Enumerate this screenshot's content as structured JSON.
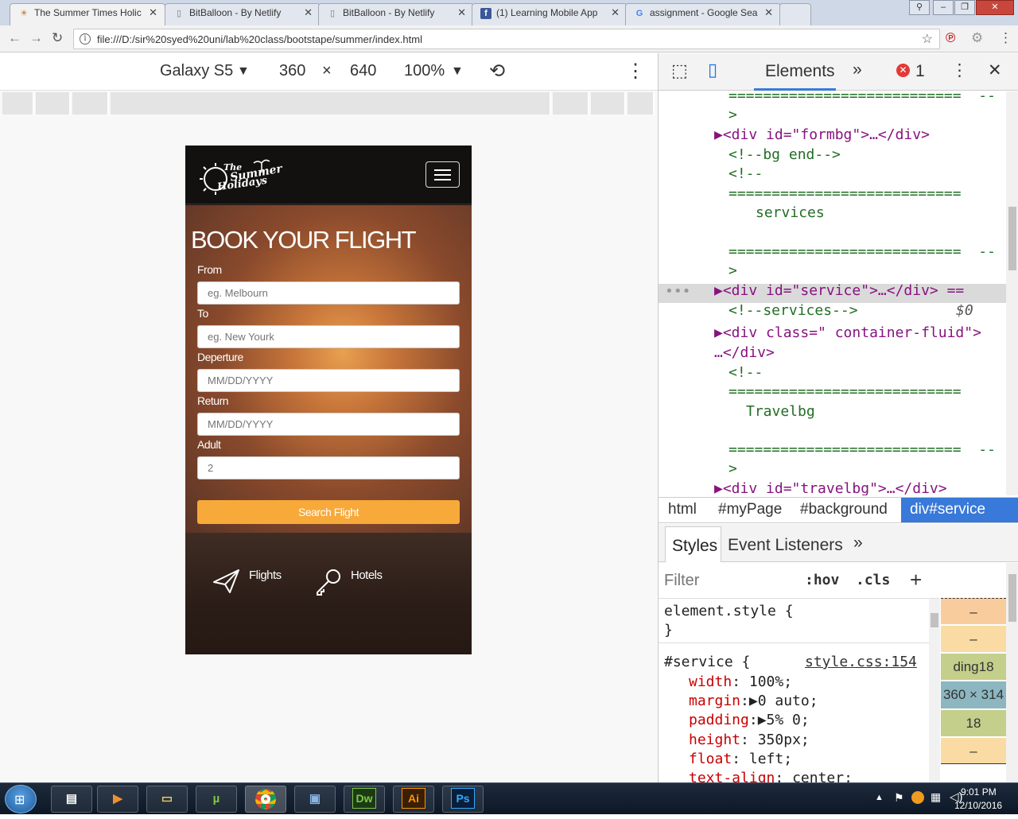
{
  "browser": {
    "tabs": [
      {
        "title": "The Summer Times Holic",
        "icon": "palm-favicon",
        "active": true
      },
      {
        "title": "BitBalloon - By Netlify",
        "icon": "page-favicon"
      },
      {
        "title": "BitBalloon - By Netlify",
        "icon": "page-favicon"
      },
      {
        "title": "(1) Learning Mobile App",
        "icon": "facebook-favicon"
      },
      {
        "title": "assignment - Google Sea",
        "icon": "google-favicon"
      }
    ],
    "url": "file:///D:/sir%20syed%20uni/lab%20class/bootstape/summer/index.html"
  },
  "device_toolbar": {
    "device": "Galaxy S5",
    "width": "360",
    "times": "×",
    "height": "640",
    "zoom": "100%"
  },
  "page": {
    "logo_text": [
      "The",
      "Summer",
      "Holidays"
    ],
    "heading": "BOOK YOUR FLIGHT",
    "fields": [
      {
        "label": "From",
        "placeholder": "eg. Melbourn"
      },
      {
        "label": "To",
        "placeholder": "eg. New Yourk"
      },
      {
        "label": "Deperture",
        "placeholder": "MM/DD/YYYY"
      },
      {
        "label": "Return",
        "placeholder": "MM/DD/YYYY"
      },
      {
        "label": "Adult",
        "placeholder": "2"
      }
    ],
    "search_button": "Search Flight",
    "services": [
      "Flights",
      "Hotels"
    ]
  },
  "devtools": {
    "panel_tab": "Elements",
    "more": "»",
    "error_count": "1",
    "dom_lines": [
      "===========================  --",
      ">",
      "▶<div id=\"formbg\">…</div>",
      "<!--bg end-->",
      "<!--",
      "===========================",
      "services",
      "===========================  --",
      ">",
      "▶<div id=\"service\">…</div> ==",
      "<!--services-->",
      "$0",
      "▶<div class=\" container-fluid\">",
      "…</div>",
      "<!--",
      "===========================",
      "Travelbg",
      "===========================  --",
      ">",
      "▶<div id=\"travelbg\">…</div>"
    ],
    "breadcrumbs": [
      "html",
      "#myPage",
      "#background",
      "div#service"
    ],
    "styles_tabs": [
      "Styles",
      "Event Listeners"
    ],
    "filter_placeholder": "Filter",
    "hov": ":hov",
    "cls": ".cls",
    "rules": {
      "element_style": "element.style {",
      "close": "}",
      "selector": "#service {",
      "source": "style.css:154",
      "props": [
        {
          "name": "width",
          "value": "100%;"
        },
        {
          "name": "margin",
          "value": "▶0 auto;"
        },
        {
          "name": "padding",
          "value": "▶5% 0;"
        },
        {
          "name": "height",
          "value": "350px;"
        },
        {
          "name": "float",
          "value": "left;"
        },
        {
          "name": "text-align",
          "value": "center;"
        }
      ]
    },
    "box_model": [
      "–",
      "–",
      "ding",
      "18",
      "360 × 314",
      "18",
      "–"
    ]
  },
  "taskbar": {
    "apps": [
      "Dw",
      "Ai",
      "Ps"
    ],
    "time": "9:01 PM",
    "date": "12/10/2016"
  }
}
